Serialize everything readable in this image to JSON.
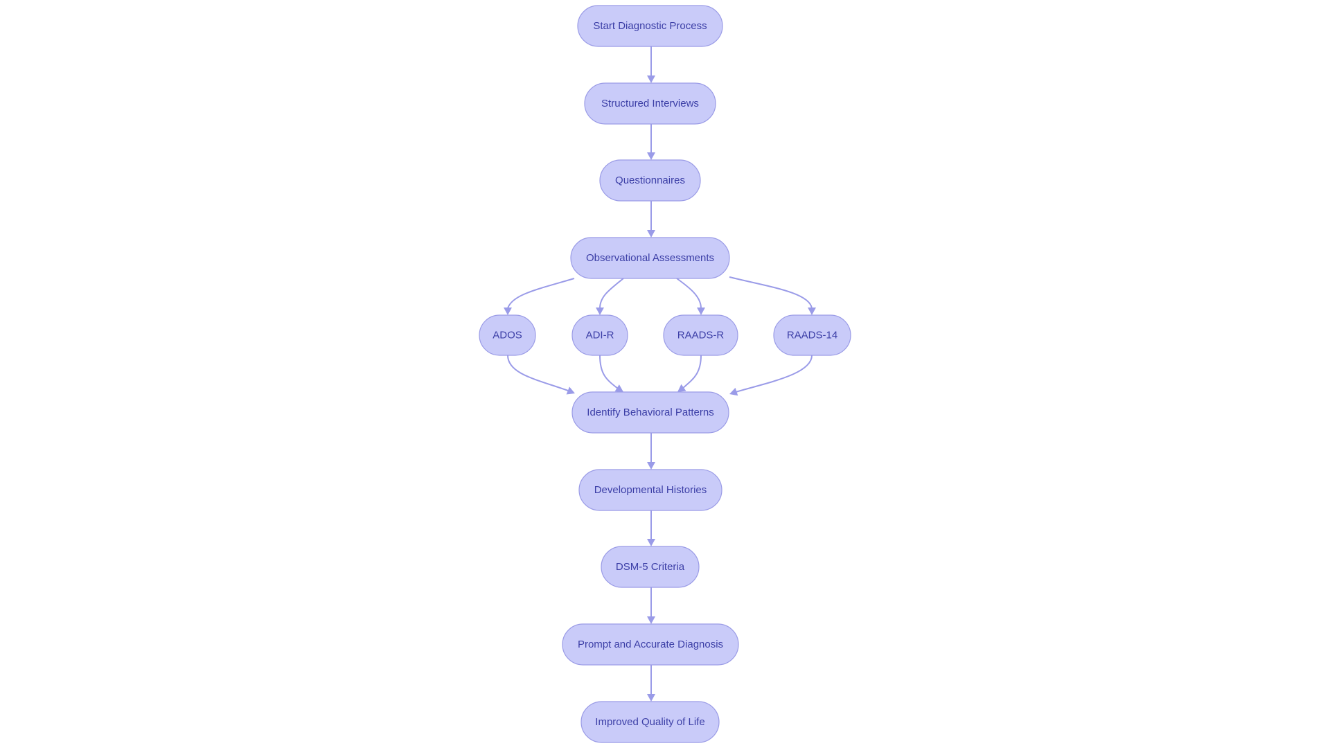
{
  "diagram": {
    "type": "flowchart",
    "direction": "top-to-bottom",
    "colors": {
      "node_fill": "#c9cbf9",
      "node_stroke": "#9a9be6",
      "edge": "#9a9be8",
      "text": "#3b3ea6"
    },
    "nodes": [
      {
        "id": "start",
        "label": "Start Diagnostic Process"
      },
      {
        "id": "interviews",
        "label": "Structured Interviews"
      },
      {
        "id": "questionnaires",
        "label": "Questionnaires"
      },
      {
        "id": "observational",
        "label": "Observational Assessments"
      },
      {
        "id": "ados",
        "label": "ADOS"
      },
      {
        "id": "adir",
        "label": "ADI-R"
      },
      {
        "id": "raadsr",
        "label": "RAADS-R"
      },
      {
        "id": "raads14",
        "label": "RAADS-14"
      },
      {
        "id": "identify",
        "label": "Identify Behavioral Patterns"
      },
      {
        "id": "histories",
        "label": "Developmental Histories"
      },
      {
        "id": "dsm5",
        "label": "DSM-5 Criteria"
      },
      {
        "id": "diagnosis",
        "label": "Prompt and Accurate Diagnosis"
      },
      {
        "id": "quality",
        "label": "Improved Quality of Life"
      }
    ],
    "edges": [
      {
        "from": "start",
        "to": "interviews"
      },
      {
        "from": "interviews",
        "to": "questionnaires"
      },
      {
        "from": "questionnaires",
        "to": "observational"
      },
      {
        "from": "observational",
        "to": "ados"
      },
      {
        "from": "observational",
        "to": "adir"
      },
      {
        "from": "observational",
        "to": "raadsr"
      },
      {
        "from": "observational",
        "to": "raads14"
      },
      {
        "from": "ados",
        "to": "identify"
      },
      {
        "from": "adir",
        "to": "identify"
      },
      {
        "from": "raadsr",
        "to": "identify"
      },
      {
        "from": "raads14",
        "to": "identify"
      },
      {
        "from": "identify",
        "to": "histories"
      },
      {
        "from": "histories",
        "to": "dsm5"
      },
      {
        "from": "dsm5",
        "to": "diagnosis"
      },
      {
        "from": "diagnosis",
        "to": "quality"
      }
    ]
  }
}
